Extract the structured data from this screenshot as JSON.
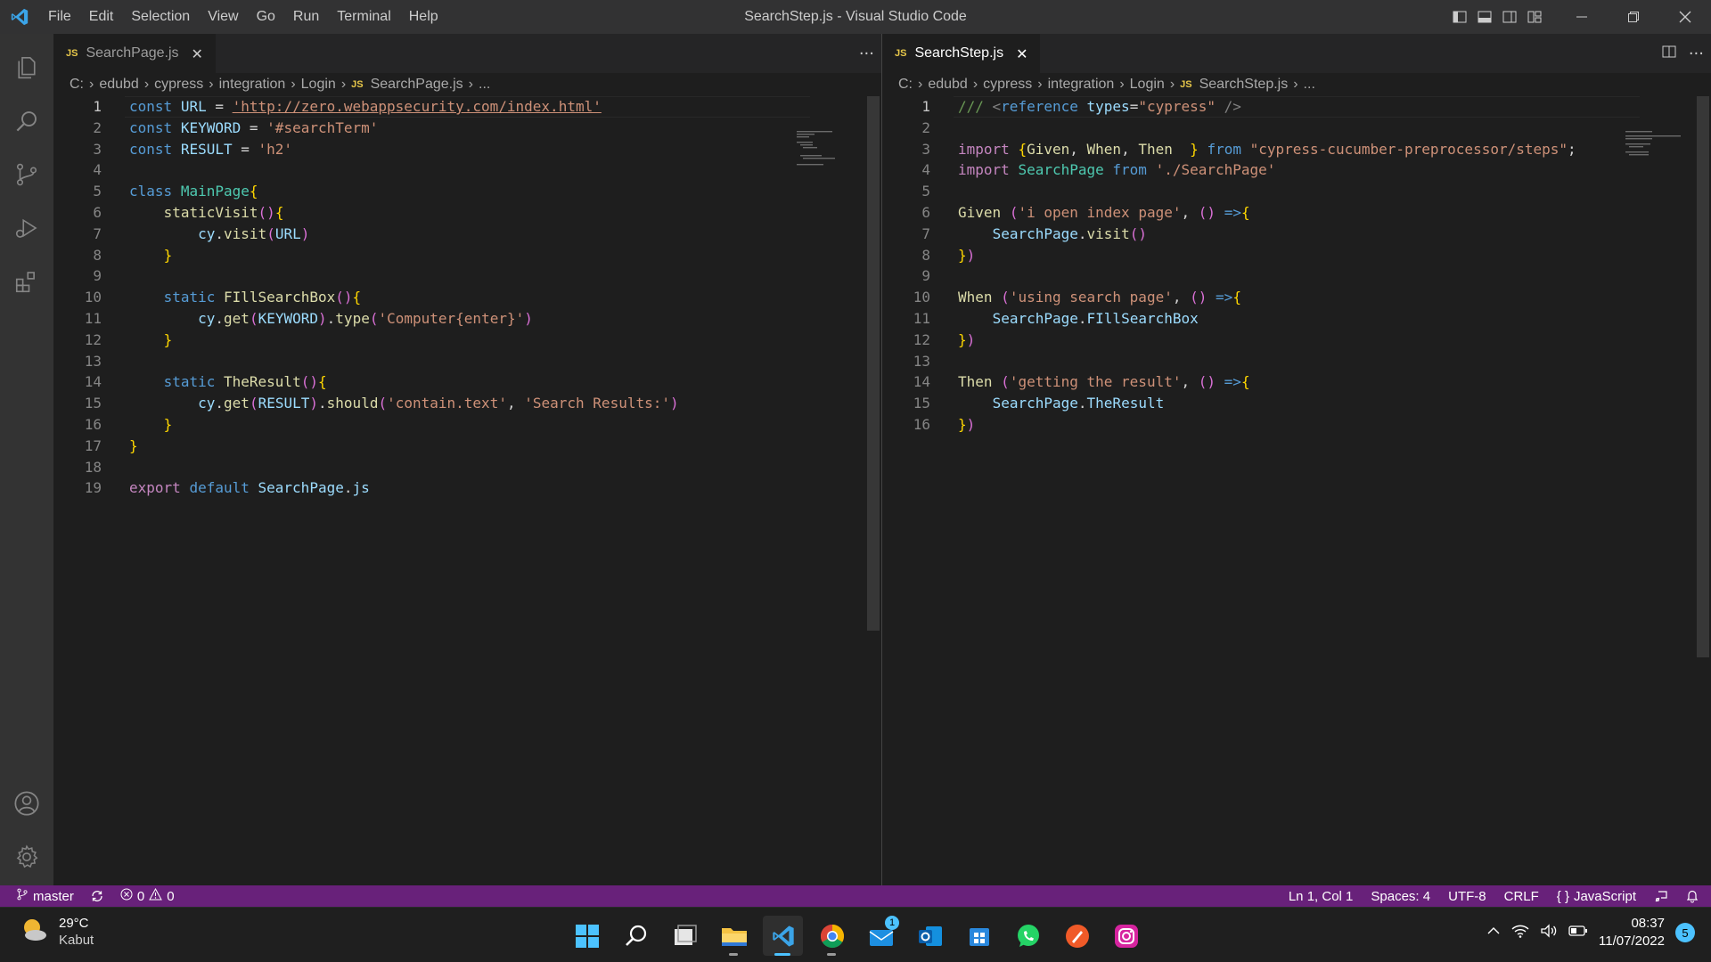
{
  "window": {
    "title": "SearchStep.js - Visual Studio Code"
  },
  "menu": [
    "File",
    "Edit",
    "Selection",
    "View",
    "Go",
    "Run",
    "Terminal",
    "Help"
  ],
  "left_editor": {
    "tab": {
      "label": "SearchPage.js",
      "badge": "JS"
    },
    "breadcrumb": [
      "C:",
      "edubd",
      "cypress",
      "integration",
      "Login",
      "SearchPage.js",
      "..."
    ],
    "line_numbers": [
      "1",
      "2",
      "3",
      "4",
      "5",
      "6",
      "7",
      "8",
      "9",
      "10",
      "11",
      "12",
      "13",
      "14",
      "15",
      "16",
      "17",
      "18",
      "19"
    ],
    "code": [
      "const URL = 'http://zero.webappsecurity.com/index.html'",
      "const KEYWORD = '#searchTerm'",
      "const RESULT = 'h2'",
      "",
      "class MainPage{",
      "    staticVisit(){",
      "        cy.visit(URL)",
      "    }",
      "",
      "    static FIllSearchBox(){",
      "        cy.get(KEYWORD).type('Computer{enter}')",
      "    }",
      "",
      "    static TheResult(){",
      "        cy.get(RESULT).should('contain.text', 'Search Results:')",
      "    }",
      "}",
      "",
      "export default SearchPage.js"
    ]
  },
  "right_editor": {
    "tab": {
      "label": "SearchStep.js",
      "badge": "JS"
    },
    "breadcrumb": [
      "C:",
      "edubd",
      "cypress",
      "integration",
      "Login",
      "SearchStep.js",
      "..."
    ],
    "line_numbers": [
      "1",
      "2",
      "3",
      "4",
      "5",
      "6",
      "7",
      "8",
      "9",
      "10",
      "11",
      "12",
      "13",
      "14",
      "15",
      "16"
    ],
    "code": [
      "/// <reference types=\"cypress\" />",
      "",
      "import {Given, When, Then  } from \"cypress-cucumber-preprocessor/steps\";",
      "import SearchPage from './SearchPage'",
      "",
      "Given ('i open index page', () =>{",
      "    SearchPage.visit()",
      "})",
      "",
      "When ('using search page', () =>{",
      "    SearchPage.FIllSearchBox",
      "})",
      "",
      "Then ('getting the result', () =>{",
      "    SearchPage.TheResult",
      "})"
    ]
  },
  "statusbar": {
    "branch": "master",
    "errors": "0",
    "warnings": "0",
    "position": "Ln 1, Col 1",
    "spaces": "Spaces: 4",
    "encoding": "UTF-8",
    "eol": "CRLF",
    "language": "JavaScript",
    "color": "#68217a"
  },
  "taskbar": {
    "weather": {
      "temp": "29°C",
      "condition": "Kabut"
    },
    "mail_badge": "1",
    "time": "08:37",
    "date": "11/07/2022",
    "notifications": "5",
    "apps": [
      "start-icon",
      "search-icon",
      "task-view-icon",
      "file-explorer-icon",
      "vscode-icon",
      "chrome-icon",
      "mail-icon",
      "outlook-icon",
      "store-icon",
      "whatsapp-icon",
      "app-icon",
      "instagram-icon"
    ]
  }
}
